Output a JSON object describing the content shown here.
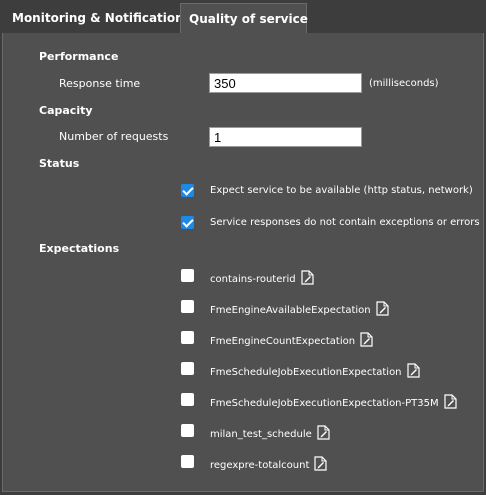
{
  "tabs": [
    {
      "label": "Monitoring & Notification",
      "active": false
    },
    {
      "label": "Quality of service",
      "active": true
    }
  ],
  "performance": {
    "title": "Performance",
    "response_time_label": "Response time",
    "response_time_value": "350",
    "response_time_unit": "(milliseconds)"
  },
  "capacity": {
    "title": "Capacity",
    "requests_label": "Number of requests",
    "requests_value": "1"
  },
  "status": {
    "title": "Status",
    "items": [
      {
        "label": "Expect service to be available (http status, network)",
        "checked": true
      },
      {
        "label": "Service responses do not contain exceptions or errors",
        "checked": true
      }
    ]
  },
  "expectations": {
    "title": "Expectations",
    "items": [
      {
        "label": "contains-routerid",
        "checked": false,
        "icon": "edit-document-icon"
      },
      {
        "label": "FmeEngineAvailableExpectation",
        "checked": false,
        "icon": "edit-document-icon"
      },
      {
        "label": "FmeEngineCountExpectation",
        "checked": false,
        "icon": "edit-document-icon"
      },
      {
        "label": "FmeScheduleJobExecutionExpectation",
        "checked": false,
        "icon": "edit-document-icon"
      },
      {
        "label": "FmeScheduleJobExecutionExpectation-PT35M",
        "checked": false,
        "icon": "edit-document-icon"
      },
      {
        "label": "milan_test_schedule",
        "checked": false,
        "icon": "edit-document-icon"
      },
      {
        "label": "regexpre-totalcount",
        "checked": false,
        "icon": "edit-document-icon"
      }
    ]
  },
  "colors": {
    "background": "#3d3d3d",
    "panel": "#505050",
    "accent": "#1e88e5"
  }
}
